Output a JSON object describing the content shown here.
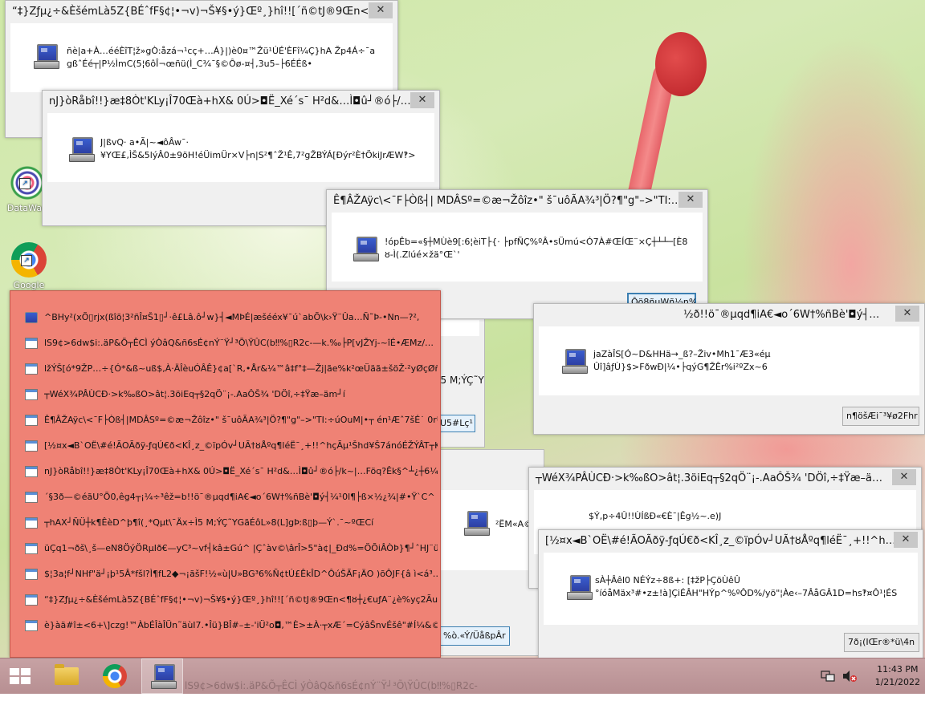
{
  "desktop": {
    "icons": [
      {
        "label": "DataWag",
        "glyph": "datawag-icon"
      },
      {
        "label": "Google",
        "glyph": "chrome-icon"
      }
    ]
  },
  "windows": {
    "w1": {
      "title": "“‡}Zƒµ¿÷&ÈšémLà5Z{BÉˆfF§¢¦•¬v)¬Š¥§•ý}Œº¸}hî!![´ñ©tJ®9Œn<…",
      "line1": "ñè|a+À…ééÈîT¦ž»gÒ:åzá¬¹cç+…Á}|)è0¤™Žü¹ÚÉ'ÈFî¼Ç}hA    Žp4Á÷¯a",
      "line2": "gßˆÉé┬|P½ÌmC(5¦6ôÎ¬œñü(Ì_C¾¯§©Ôø-¤┤,3u5–├6ÉÉß•"
    },
    "w2": {
      "title": "nJ}òRåbî!!}æ‡8Òt'KLy¡Î70Œà+hX& 0Ú>◘Ë_Xé´s¯   H²d&…Ì◘û┘®ó├/…",
      "line1": "J|ßvQ·   a•Ã|~◄ôÂw¯·",
      "line2": "¥YŒ£,ÌŠ&5lýÂ0±9öH!éÜimÜr×V├n|S²¶ˆŽ¹Ê,7²gŽBÝÁ[Ðýr²È†ÖkiJrÆW‽>"
    },
    "w3": {
      "title": "Ê¶ÂŽAÿc\\<¯F├Òß┤| MDÂSº=©æ¬Žôîz•\" š¯uôÃA¾³|Ö?¶\"g\"–>\"TI:…",
      "line1": "!ópÊb=«§┼MÙè9[:6¦èiT├{· ├pfÑÇ%ºÂ•sÜmú<Ó7À#ŒÍŒ¨×Ç┼┴┴─[È8",
      "line2": "ȣ-Ì(.Zlúé×žä°Œ`'",
      "button": "Ôö8ñµWñ½n%"
    },
    "w4": {
      "title": "½ð!!ö¯®µqd¶iA€◄o´6W†%ñBè'◘ý┤…",
      "line1": "jaZàÎS[Ó~D&HHä→_ß?–Živ•Mh1¯Æ3«éµ",
      "line2": "Ûî]âƒÙ}$>FðwÐ|¼•├qýG¶ŽÊr%i²ºZx~6",
      "button": "n¶öšÆi¯³¥ø2Fhr"
    },
    "w5": {
      "title": "┬WéX¾PÂÙCÐ·>k‰ßO>ât¦.3öiEq┬§2qÖ¨¡-.AaÔŠ¾ 'DÖî,÷‡Ÿæ–ä…",
      "line1": "$Ý,p÷4Û!!ÙÍßÐ«€È¯|Êg½~.e)J",
      "line2": ""
    },
    "w6": {
      "title": "[½¤x◄B`OË\\#é!ÃOÃðÿ-ƒqÚ€ð<KÎ¸z_©ïpÓv┘UÃ†ȣÅºq¶léË¯¸+!!^h…",
      "line1": "sÀ┼Âêl0  NÉÝz÷8ß+: [‡žP├ÇöÙêÛ",
      "line2": "°íóåMäx³#•z±!à]ÇiÉÂH\"HÝp^%ºÔD%/yö\"¦Àe‹–7ÂåGÂ1D=hs‽¤Ô¹¦ÉS",
      "button": "7ð¡(IŒr®*ü\\4n"
    }
  },
  "partials": {
    "p_a": {
      "text": "Ì5 M;ÝÇ˜Y"
    },
    "p_b": {
      "text": "U5#Lç¹"
    },
    "p_c": {
      "text": "²ËM«A©"
    },
    "p_d": {
      "text": "%ò.«Ý/ÜåßpÂr"
    }
  },
  "list_window": {
    "items": [
      {
        "icon": "pc-icon",
        "text": "^BHy²(xÕ▯rjx(ßîõ¦3²ñÎ¤Š1▯┘·ê£Lâ.ô┘w}┤◄MÞÉ|æšééx¥¯ú`abÕ\\k›Ÿ¨Ûa…Ñ˜Þ-•Nn—?²,"
      },
      {
        "icon": "app-icon",
        "text": "lS9¢>6dw$i:.äP&Õ┬ÊCÌ ýÒâQ&ñ6sÉ¢nÝ¨Ÿ┘³Õ\\ŸÛC(b‼%▯R2c-—k.‰├P[vJŽYj-~îÉ•ÆMz/…"
      },
      {
        "icon": "app-icon",
        "text": "lžÝŠ[ó*9ŽP…÷{Ó*&ß~uß$,À·ÄÎèuÓÂÊ}¢a[`R,•År&¼™â‡f°‡—Žj|ãe%k²œÜäã±šöŽ·²yØçØñ^…"
      },
      {
        "icon": "app-icon",
        "text": "┬WéX¾PÂÙCÐ·>k‰ßO>ât¦.3öiEq┬§2qÖ¨¡-.AaÔŠ¾ 'DÖî,÷‡Ÿæ–äm┘í"
      },
      {
        "icon": "app-icon",
        "text": "Ê¶ÂŽAÿc\\<¯F├Òß┤|MDÂSº=©æ¬Žôîz•\" š¯uôÃA¾³|Ö?¶\"g\"–>\"TI:÷úOuM|•┬ én¹Æˆ7šÉ˙  0rÜŒ…"
      },
      {
        "icon": "app-icon",
        "text": "[½¤x◄B`OË\\#é!ÃOÃðÿ-ƒqÚ€ð<KÎ¸z_©ïpÓv┘UÃ†ȣÅºq¶léË¯¸+!!^hçÃµ¹Šhd¥Š7ánóÉŽÝÂT┬KÍ…"
      },
      {
        "icon": "app-icon",
        "text": "nJ}òRåbî!!}æ‡8Òt'KLy¡Î70Œà+hX& 0Ú>◘Ë_Xé´s¯   H²d&…Ì◘û┘®ó├/k~|…Föq?Êk§^┴¿┼6¼ÙÓ³…"
      },
      {
        "icon": "app-icon",
        "text": "´§3ð—©éãU°Õ0,êg4┬¡¼÷³êž=b!!ö¯®µqd¶iA€◄o´6W†%ñBè'◘ý┤¼¹0l¶├ß×½¿¾|#•Ÿ`C^  g…"
      },
      {
        "icon": "app-icon",
        "text": "┬hAX┘ÑÜ┼k¶ÊèD^þ¶î(¸*Qµt\\¯Äx÷Ì5 M;ÝÇ˜YGãÉôL»8(L]gÞ:ß▯þ—Ý`.¯~ºŒCí"
      },
      {
        "icon": "app-icon",
        "text": "üÇq1¬ðš\\¸š—eN8ÖýÖRµIð€—yC³~vf┤kâ±Gú^ |Çˆàv©\\ârÎ>5\"à¢|_Ðd%=ÖÕiÂÒÞ}¶┘ˆHJ¨ü…"
      },
      {
        "icon": "app-icon",
        "text": "$¦3a¦f┘NHf\"ä┘¡þ¹5Â*fšl?Ì¶fL2◆¬¡ãšF!½«ù|U»BG³6%Ñ¢tÚ£ÊkÎD^ÔúŠÃF¡ÄO  )õÔJF{â   ì<á³…"
      },
      {
        "icon": "app-icon",
        "text": "“‡}Zƒµ¿÷&ÈšémLà5Z{BÉˆfF§¢¦•¬v)¬Š¥§•ý}Œº¸}hî!![´ñ©tJ®9Œn<¶ȣ┼¿€uƒA¨¿è%yç2ÃuWÃT…"
      },
      {
        "icon": "app-icon",
        "text": "è}àä#î±<6+\\]czg!™ÀbÉÎàÎÜn˜äùI7.•Îü}BÎ#–±-'iÜ²o◘,™È>±À·┬xÆ´=CýâŠnvÉšê\"#Í¼&©¦ŽÝ0ë…"
      }
    ]
  },
  "taskbar": {
    "ghost_text": "lS9¢>6dw$i:.äP&Õ┬ÊCÌ ýÒâQ&ñ6sÉ¢nÝ¨Ÿ┘³Õ\\ŸÛC(b‼%▯R2c-",
    "time": "11:43 PM",
    "date": "1/21/2022"
  }
}
